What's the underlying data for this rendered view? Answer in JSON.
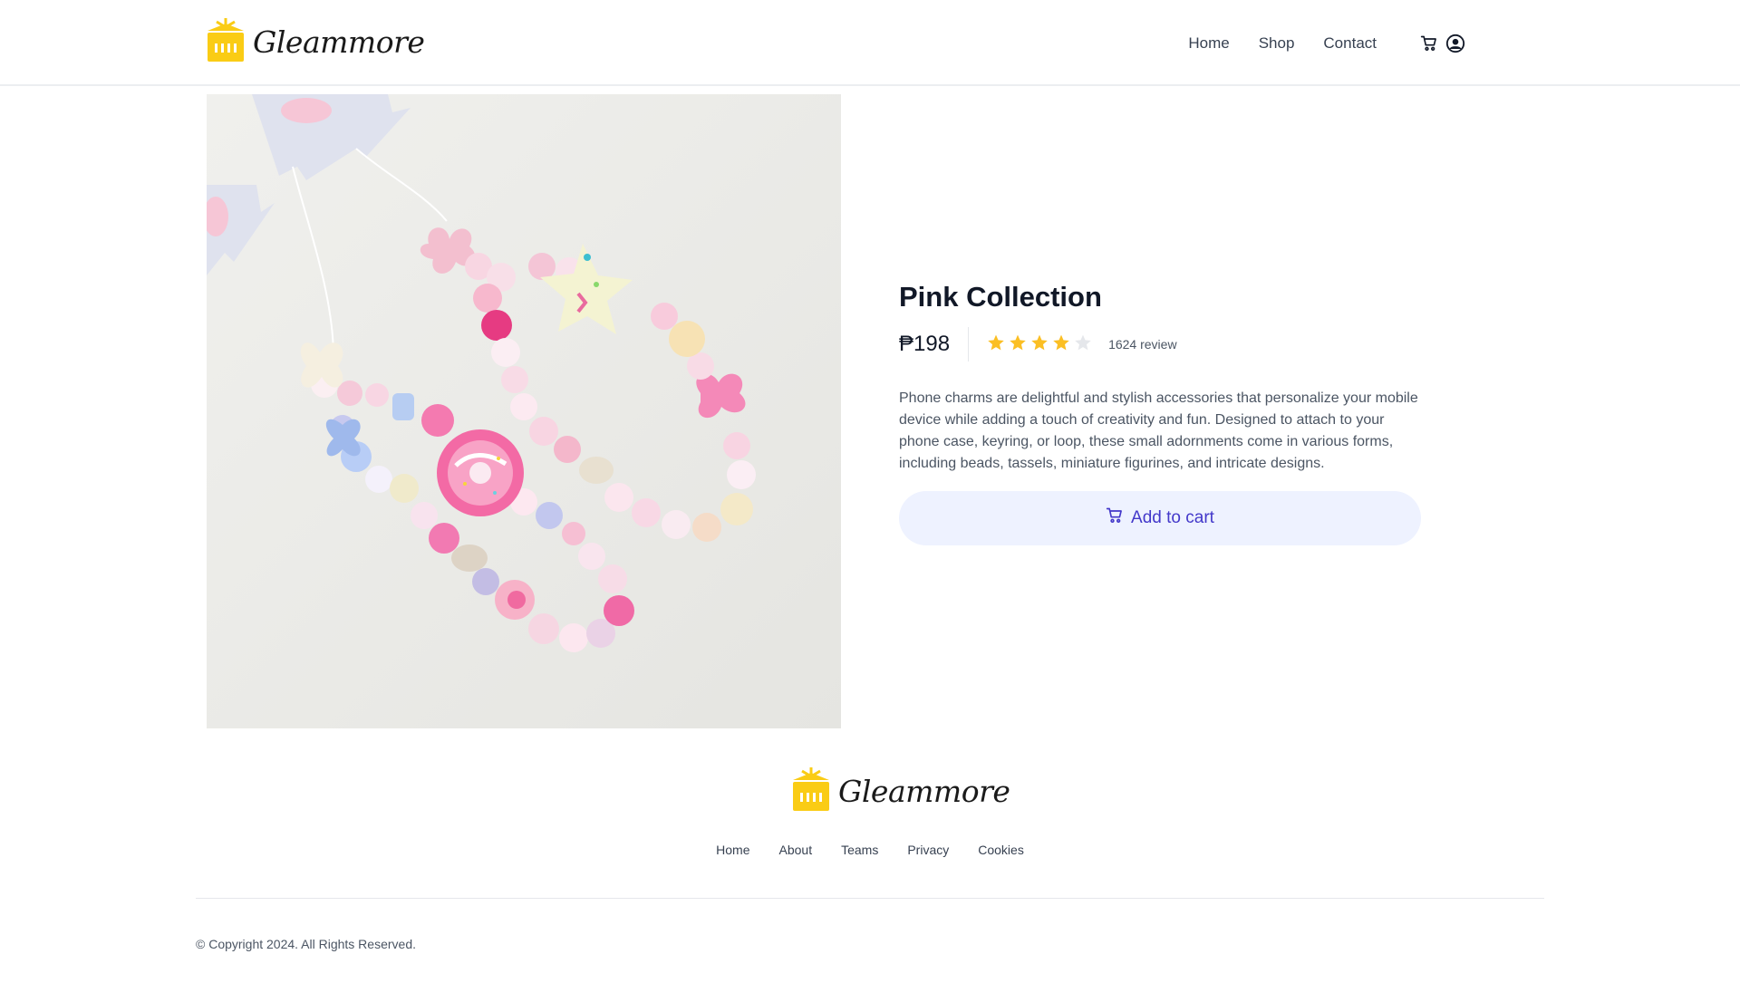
{
  "brand": {
    "name": "Gleammore",
    "logo_color": "#facc15"
  },
  "nav": {
    "items": [
      {
        "label": "Home"
      },
      {
        "label": "Shop"
      },
      {
        "label": "Contact"
      }
    ],
    "icons": [
      "cart-icon",
      "user-account-icon"
    ]
  },
  "product": {
    "title": "Pink Collection",
    "price": "₱198",
    "rating": 4,
    "rating_max": 5,
    "reviews_label": "1624 review",
    "description": "Phone charms are delightful and stylish accessories that personalize your mobile device while adding a touch of creativity and fun. Designed to attach to your phone case, keyring, or loop, these small adornments come in various forms, including beads, tassels, miniature figurines, and intricate designs.",
    "add_to_cart_label": "Add to cart",
    "star_color": "#fbbf24",
    "accent_color": "#4338ca"
  },
  "footer": {
    "links": [
      {
        "label": "Home"
      },
      {
        "label": "About"
      },
      {
        "label": "Teams"
      },
      {
        "label": "Privacy"
      },
      {
        "label": "Cookies"
      }
    ],
    "copyright": "© Copyright 2024. All Rights Reserved."
  }
}
